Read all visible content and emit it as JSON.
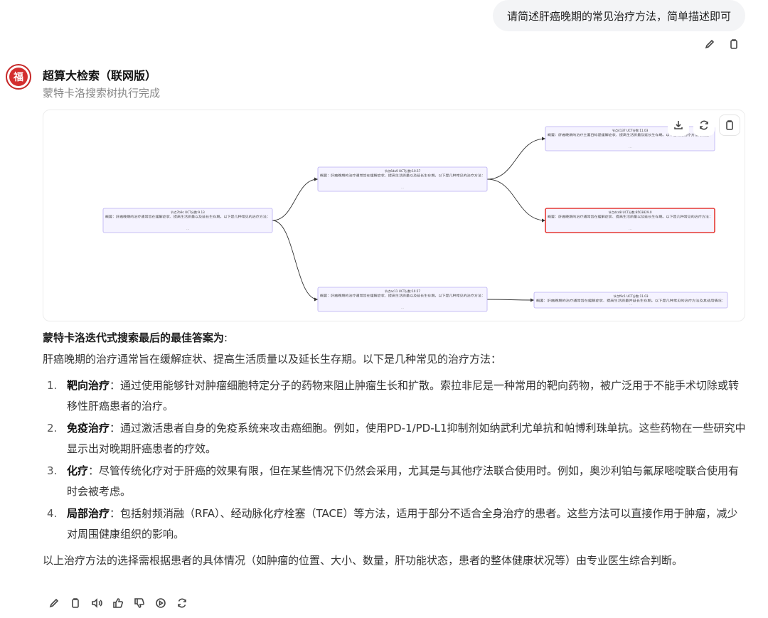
{
  "user_message": "请简述肝癌晚期的常见治疗方法，简单描述即可",
  "user_actions": [
    {
      "name": "edit-icon"
    },
    {
      "name": "copy-icon"
    }
  ],
  "bot": {
    "name": "超算大检索（联网版）",
    "avatar_text": "福",
    "status": "蒙特卡洛搜索树执行完成"
  },
  "tree": {
    "tools": [
      "download-icon",
      "refresh-icon",
      "copy-icon"
    ],
    "nodes": [
      {
        "id": "root",
        "title": "节点7b9c UCT分数:9.13",
        "body": "概要：肝癌晚期的治疗通常旨在缓解症状、提高生活质量以及延长生存期。以下是几种常见的治疗方法：",
        "highlight": false
      },
      {
        "id": "a",
        "title": "节点6da9 UCT分数:10.57",
        "body": "概要：肝癌晚期的治疗通常旨在缓解症状、提高生活质量以及延长生存期。以下是几种常见的治疗方法：",
        "highlight": false
      },
      {
        "id": "b",
        "title": "节点ac11 UCT分数:10.57",
        "body": "概要：肝癌晚期的治疗通常旨在缓解症状、提高生活质量以及延长生存期。以下是几种常见的治疗方法：",
        "highlight": false
      },
      {
        "id": "a1",
        "title": "节点4137 UCT分数:11.03",
        "body": "概要：肝癌晚期的治疗主要目标是缓解症状、提高生活质量及延长生存期。以下是常见治疗方法的概述：",
        "highlight": false
      },
      {
        "id": "a2",
        "title": "节点dcd8 UCT分数:8503829.0",
        "body": "概要：肝癌晚期的治疗通常旨在缓解症状、提高生活质量以及延长生存期。以下是几种常见的治疗方法：",
        "highlight": true
      },
      {
        "id": "b1",
        "title": "节点f9c1 UCT分数:11.03",
        "body": "概要：肝癌晚期的治疗通常旨在缓解症状、提高生活质量并延长生存期。以下是几种常见的治疗方法及其适用情况：",
        "highlight": false
      }
    ],
    "colors": {
      "node_bg": "#f5f3ff",
      "node_border": "#b9aef2",
      "highlight_border": "#e53935",
      "edge": "#333333"
    }
  },
  "answer": {
    "heading": "蒙特卡洛迭代式搜索最后的最佳答案为",
    "heading_suffix": ":",
    "intro": "肝癌晚期的治疗通常旨在缓解症状、提高生活质量以及延长生存期。以下是几种常见的治疗方法：",
    "items": [
      {
        "num": "1.",
        "title": "靶向治疗",
        "text": "：通过使用能够针对肿瘤细胞特定分子的药物来阻止肿瘤生长和扩散。索拉非尼是一种常用的靶向药物，被广泛用于不能手术切除或转移性肝癌患者的治疗。"
      },
      {
        "num": "2.",
        "title": "免疫治疗",
        "text": "：通过激活患者自身的免疫系统来攻击癌细胞。例如，使用PD-1/PD-L1抑制剂如纳武利尤单抗和帕博利珠单抗。这些药物在一些研究中显示出对晚期肝癌患者的疗效。"
      },
      {
        "num": "3.",
        "title": "化疗",
        "text": "：尽管传统化疗对于肝癌的效果有限，但在某些情况下仍然会采用，尤其是与其他疗法联合使用时。例如，奥沙利铂与氟尿嘧啶联合使用有时会被考虑。"
      },
      {
        "num": "4.",
        "title": "局部治疗",
        "text": "：包括射频消融（RFA）、经动脉化疗栓塞（TACE）等方法，适用于部分不适合全身治疗的患者。这些方法可以直接作用于肿瘤，减少对周围健康组织的影响。"
      }
    ],
    "conclusion": "以上治疗方法的选择需根据患者的具体情况（如肿瘤的位置、大小、数量，肝功能状态，患者的整体健康状况等）由专业医生综合判断。"
  },
  "bottom_actions": [
    "edit-icon",
    "copy-icon",
    "speaker-icon",
    "thumbs-up-icon",
    "thumbs-down-icon",
    "play-icon",
    "regenerate-icon"
  ]
}
